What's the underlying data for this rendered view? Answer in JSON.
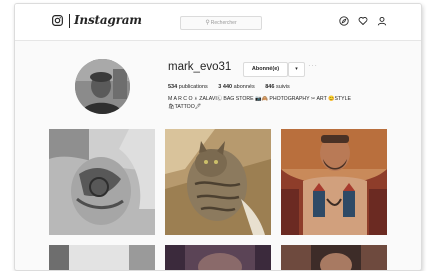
{
  "header": {
    "wordmark": "Instagram",
    "search_placeholder": "Rechercher"
  },
  "icons": {
    "logo": "instagram-camera-icon",
    "explore": "compass-icon",
    "activity": "heart-icon",
    "profile": "person-icon",
    "search": "search-icon",
    "dropdown": "caret-down-icon"
  },
  "profile": {
    "username": "mark_evo31",
    "follow_label": "Abonné(e)",
    "dropdown_symbol": "▾",
    "more_symbol": "···",
    "stats": [
      {
        "value": "534",
        "label": "publications"
      },
      {
        "value": "3 440",
        "label": "abonnés"
      },
      {
        "value": "846",
        "label": "suivis"
      }
    ],
    "bio_line1": "M A R C O ♅ ZALAVIⓁ BAG STORE 📷🙈 PHOTOGRAPHY ✂ ART 😊STYLE",
    "bio_line2": "🛍TATTOO🖊"
  },
  "posts": [
    {
      "alt": "tattooed-torso-bw"
    },
    {
      "alt": "tabby-cat-on-bed"
    },
    {
      "alt": "tattooed-chest-selfie"
    },
    {
      "alt": "partial-post-1"
    },
    {
      "alt": "partial-post-2"
    },
    {
      "alt": "partial-post-3"
    }
  ],
  "colors": {
    "text": "#262626",
    "border": "#dbdbdb",
    "background": "#fafafa"
  }
}
